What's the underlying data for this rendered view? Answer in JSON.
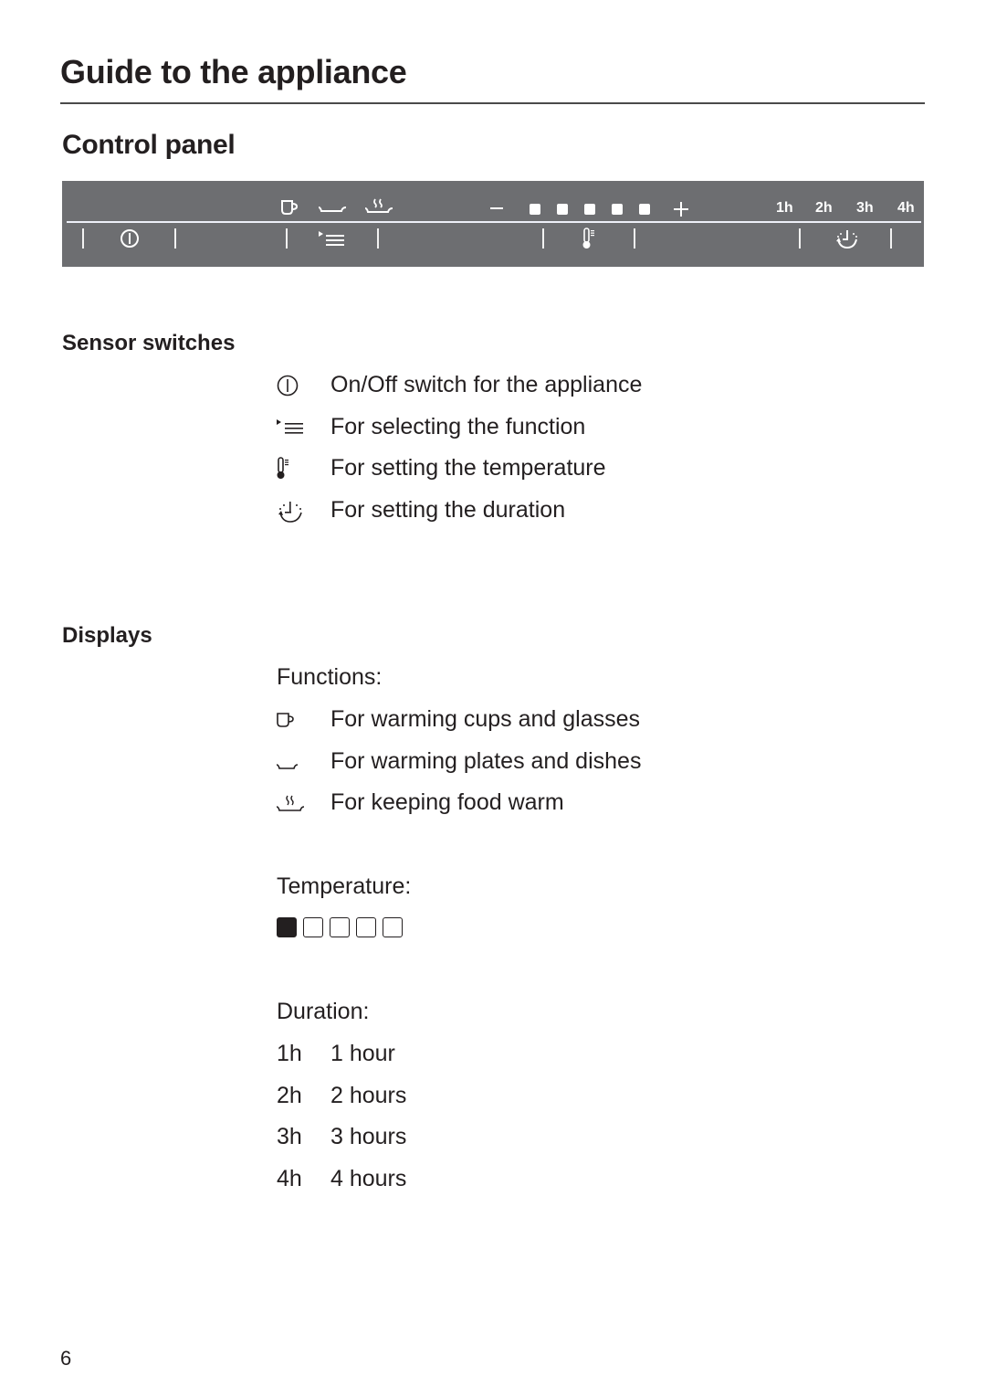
{
  "header": {
    "title": "Guide to the appliance",
    "section": "Control panel"
  },
  "panel": {
    "top_icons": [
      "cup-icon",
      "plate-icon",
      "steam-food-icon"
    ],
    "minus": "–",
    "plus": "+",
    "temperature_dots": 5,
    "durations": [
      "1h",
      "2h",
      "3h",
      "4h"
    ],
    "sensors": [
      "power-icon",
      "function-select-icon",
      "thermometer-icon",
      "timer-icon"
    ]
  },
  "sensor_switches": {
    "heading": "Sensor switches",
    "items": [
      {
        "icon": "power-icon",
        "text": "On/Off switch for the appliance"
      },
      {
        "icon": "function-select-icon",
        "text": "For selecting the function"
      },
      {
        "icon": "thermometer-icon",
        "text": "For setting the temperature"
      },
      {
        "icon": "timer-icon",
        "text": "For setting the duration"
      }
    ]
  },
  "displays": {
    "heading": "Displays",
    "functions_label": "Functions:",
    "functions": [
      {
        "icon": "cup-icon",
        "text": "For warming cups and glasses"
      },
      {
        "icon": "plate-icon",
        "text": "For warming plates and dishes"
      },
      {
        "icon": "steam-food-icon",
        "text": "For keeping food warm"
      }
    ],
    "temperature_label": "Temperature:",
    "temperature_level": 1,
    "temperature_levels_total": 5,
    "duration_label": "Duration:",
    "durations": [
      {
        "code": "1h",
        "text": "1 hour"
      },
      {
        "code": "2h",
        "text": "2 hours"
      },
      {
        "code": "3h",
        "text": "3 hours"
      },
      {
        "code": "4h",
        "text": "4 hours"
      }
    ]
  },
  "page_number": "6"
}
